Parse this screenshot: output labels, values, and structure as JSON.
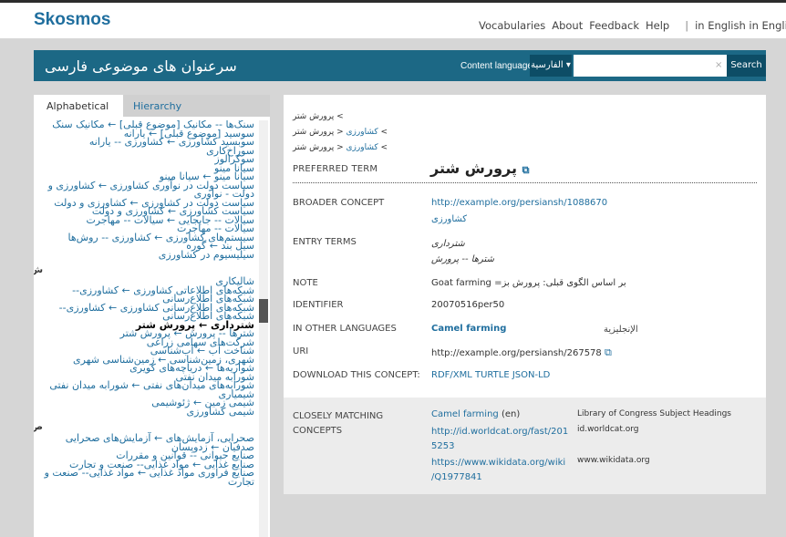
{
  "site": {
    "logo": "Skosmos"
  },
  "topnav": {
    "vocabularies": "Vocabularies",
    "about": "About",
    "feedback": "Feedback",
    "help": "Help",
    "sep": "|",
    "lang": "in English in English"
  },
  "header": {
    "vocab_title": "سرعنوان های موضوعی فارسی",
    "content_language_label": "Content language",
    "lang_selected": "الفارسية ▾",
    "search_placeholder": "",
    "clear": "×",
    "search_button": "Search"
  },
  "tabs": {
    "alphabetical": "Alphabetical",
    "hierarchy": "Hierarchy"
  },
  "alpha_list": [
    {
      "t": "سنگ‌ها -- مکانیک [موضوع قبلی] ← مکانیک سنگ",
      "b": false
    },
    {
      "t": "سوسید [موضوع قبلی] ← یارانه",
      "b": false
    },
    {
      "t": "سوبسید کشاورزی ← کشاورزی -- یارانه",
      "b": false
    },
    {
      "t": "سوراخ‌کاری",
      "b": false
    },
    {
      "t": "سوکرالوز",
      "b": false
    },
    {
      "t": "سیانا مینو",
      "b": false
    },
    {
      "t": "سیانا مینو ← سیانا مینو",
      "b": false
    },
    {
      "t": "سیاست دولت در نوآوری کشاورزی ← کشاورزی و دولت - نوآوری",
      "b": false
    },
    {
      "t": "سیاست دولت در کشاورزی ← کشاورزی و دولت",
      "b": false
    },
    {
      "t": "سیاست کشاورزی ← کشاورزی و دولت",
      "b": false
    },
    {
      "t": "سیالات -- جابجایی ← سیالات -- مهاجرت",
      "b": false
    },
    {
      "t": "سیالات -- مهاجرت",
      "b": false
    },
    {
      "t": "سیستم‌های کشاورزی ← کشاورزی -- روش‌ها",
      "b": false
    },
    {
      "t": "سیل بند ← گوره",
      "b": false
    },
    {
      "t": "سیلیسیوم در کشاورزی",
      "b": false
    }
  ],
  "alpha_letter_1": "ش",
  "alpha_list_2": [
    {
      "t": "شالیکاری",
      "b": false
    },
    {
      "t": "شبکه‌های اطلاعاتی کشاورزی ← کشاورزی-- شبکه‌های اطلاع‌رسانی",
      "b": false
    },
    {
      "t": "شبکه‌های اطلاع‌رسانی کشاورزی ← کشاورزی-- شبکه‌های اطلاع‌رسانی",
      "b": false
    },
    {
      "t": "شترداری ← پرورش شتر",
      "b": true
    },
    {
      "t": "شترها -- پرورش ← پرورش شتر",
      "b": false
    },
    {
      "t": "شرکت‌های سهامی زراعی",
      "b": false
    },
    {
      "t": "شناخت آب ← آب‌شناسی",
      "b": false
    },
    {
      "t": "شهری، زمین‌شناسی ← زمین‌شناسی شهری",
      "b": false
    },
    {
      "t": "شواریه‌ها ← دریاچه‌های کویری",
      "b": false
    },
    {
      "t": "شورابه میدان نفتی",
      "b": false
    },
    {
      "t": "شورابه‌های میدان‌های نفتی ← شورابه میدان نفتی",
      "b": false
    },
    {
      "t": "شیمیاری",
      "b": false
    },
    {
      "t": "شیمی زمین ← ژئوشیمی",
      "b": false
    },
    {
      "t": "شیمی کشاورزی",
      "b": false
    }
  ],
  "alpha_letter_2": "ص",
  "alpha_list_3": [
    {
      "t": "صحرایی، آزمایش‌های ← آزمایش‌های صحرایی",
      "b": false
    },
    {
      "t": "صدفیان ← زدوپسان",
      "b": false
    },
    {
      "t": "صنایع حیوانی -- قوانین و مقررات",
      "b": false
    },
    {
      "t": "صنایع غذایی ← مواد غذایی-- صنعت و تجارت",
      "b": false
    },
    {
      "t": "صنایع فراوری مواد غذایی ← مواد غذایی-- صنعت و تجارت",
      "b": false
    }
  ],
  "breadcrumbs": [
    {
      "link": "",
      "current": "پرورش شتر"
    },
    {
      "link": "کشاورزی",
      "current": "پرورش شتر"
    },
    {
      "link": "کشاورزی",
      "current": "پرورش شتر"
    }
  ],
  "concept": {
    "preferred_label": "PREFERRED TERM",
    "preferred_term": "پرورش شتر",
    "broader_label": "BROADER CONCEPT",
    "broader_uri": "http://example.org/persiansh/1088670",
    "broader_term": "کشاورزی",
    "entry_label": "ENTRY TERMS",
    "entry_1": "شترداری",
    "entry_2": "شترها -- پرورش",
    "note_label": "NOTE",
    "note_value": "Goat farming =بر اساس الگوی قبلی: پرورش بز",
    "identifier_label": "IDENTIFIER",
    "identifier_value": "20070516per50",
    "other_lang_label": "IN OTHER LANGUAGES",
    "other_lang_term": "Camel farming",
    "other_lang_name": "الإنجليزية",
    "uri_label": "URI",
    "uri_value": "http://example.org/persiansh/267578",
    "download_label": "DOWNLOAD THIS CONCEPT:",
    "download_value": "RDF/XML TURTLE JSON-LD",
    "closely_label_1": "CLOSELY MATCHING",
    "closely_label_2": "CONCEPTS",
    "match_1_term": "Camel farming",
    "match_1_lang": "(en)",
    "match_1_source": "Library of Congress Subject Headings",
    "match_2_uri_1": "http://id.worldcat.org/fast/201",
    "match_2_uri_2": "5253",
    "match_2_source": "id.worldcat.org",
    "match_3_uri_1": "https://www.wikidata.org/wiki",
    "match_3_uri_2": "/Q1977841",
    "match_3_source": "www.wikidata.org"
  },
  "icons": {
    "copy": "copy-icon"
  }
}
